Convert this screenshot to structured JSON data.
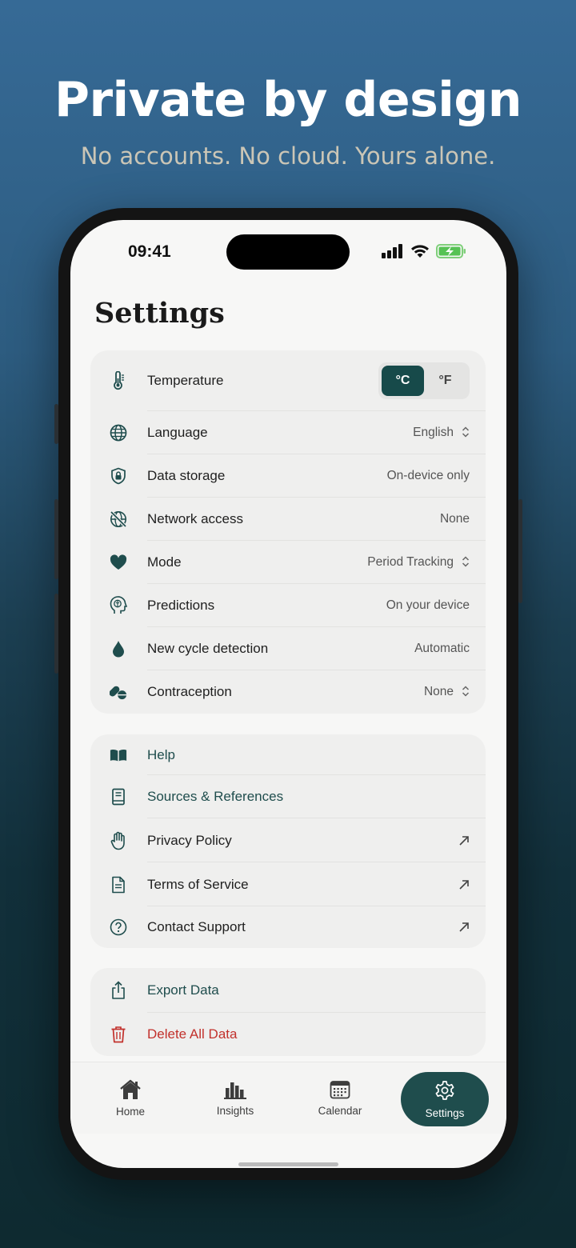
{
  "promo": {
    "headline": "Private by design",
    "subhead": "No accounts. No cloud. Yours alone."
  },
  "status_bar": {
    "time": "09:41",
    "icons": [
      "signal-icon",
      "wifi-icon",
      "battery-charging-icon"
    ]
  },
  "page_title": "Settings",
  "preferences": {
    "temperature": {
      "label": "Temperature",
      "options": [
        "°C",
        "°F"
      ],
      "selected": "°C"
    },
    "language": {
      "label": "Language",
      "value": "English"
    },
    "data_storage": {
      "label": "Data storage",
      "value": "On-device only"
    },
    "network_access": {
      "label": "Network access",
      "value": "None"
    },
    "mode": {
      "label": "Mode",
      "value": "Period Tracking"
    },
    "predictions": {
      "label": "Predictions",
      "value": "On your device"
    },
    "new_cycle": {
      "label": "New cycle detection",
      "value": "Automatic"
    },
    "contraception": {
      "label": "Contraception",
      "value": "None"
    }
  },
  "info_links": {
    "help": "Help",
    "sources": "Sources & References",
    "privacy": "Privacy Policy",
    "terms": "Terms of Service",
    "support": "Contact Support"
  },
  "data_actions": {
    "export": "Export Data",
    "delete": "Delete All Data"
  },
  "tabs": {
    "home": "Home",
    "insights": "Insights",
    "calendar": "Calendar",
    "settings": "Settings",
    "active": "settings"
  },
  "colors": {
    "accent": "#1f4d4d",
    "danger": "#c2312c",
    "background_top": "#366a96",
    "background_bottom": "#0e2a30"
  }
}
